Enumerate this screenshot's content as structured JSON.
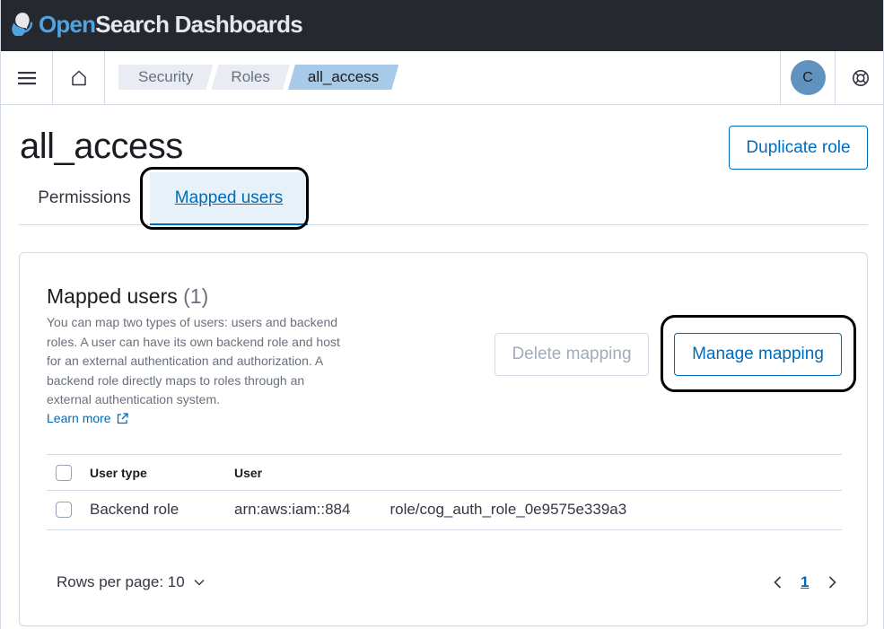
{
  "app": {
    "brand_open": "Open",
    "brand_rest": "Search Dashboards"
  },
  "header": {
    "breadcrumbs": [
      "Security",
      "Roles",
      "all_access"
    ],
    "avatar_initial": "C"
  },
  "page": {
    "title": "all_access",
    "duplicate_label": "Duplicate role",
    "tabs": [
      {
        "label": "Permissions",
        "active": false
      },
      {
        "label": "Mapped users",
        "active": true
      }
    ]
  },
  "panel": {
    "title": "Mapped users",
    "count": "(1)",
    "description": "You can map two types of users: users and backend roles. A user can have its own backend role and host for an external authentication and authorization. A backend role directly maps to roles through an external authentication system.",
    "learn_more": "Learn more",
    "delete_label": "Delete mapping",
    "manage_label": "Manage mapping",
    "table": {
      "headers": [
        "User type",
        "User"
      ],
      "rows": [
        {
          "type": "Backend role",
          "user_prefix": "arn:aws:iam::884",
          "user_suffix": "role/cog_auth_role_0e9575e339a3"
        }
      ]
    },
    "rows_per_page": "Rows per page: 10",
    "current_page": "1"
  },
  "colors": {
    "primary": "#006bb8",
    "topbar": "#25282f",
    "avatar": "#6092c0",
    "breadcrumb_active": "#a6cae8"
  },
  "icons": [
    "menu-icon",
    "home-icon",
    "help-icon",
    "external-link-icon",
    "chevron-down-icon",
    "chevron-left-icon",
    "chevron-right-icon"
  ]
}
